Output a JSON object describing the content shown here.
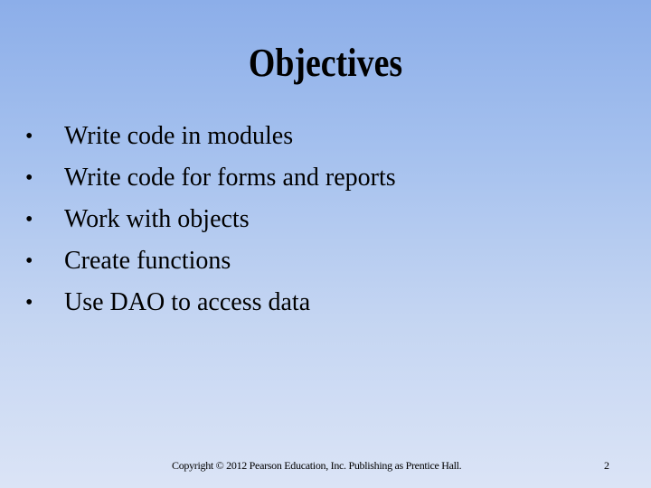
{
  "slide": {
    "title": "Objectives",
    "bullet_glyph": "•",
    "bullets": [
      "Write code in modules",
      "Write code for forms and reports",
      "Work with objects",
      "Create functions",
      "Use DAO to access data"
    ],
    "footer": "Copyright © 2012 Pearson Education, Inc. Publishing as Prentice Hall.",
    "page_number": "2"
  },
  "colors": {
    "background_top": "#8caee9",
    "background_bottom": "#dbe4f6",
    "text": "#000000"
  }
}
